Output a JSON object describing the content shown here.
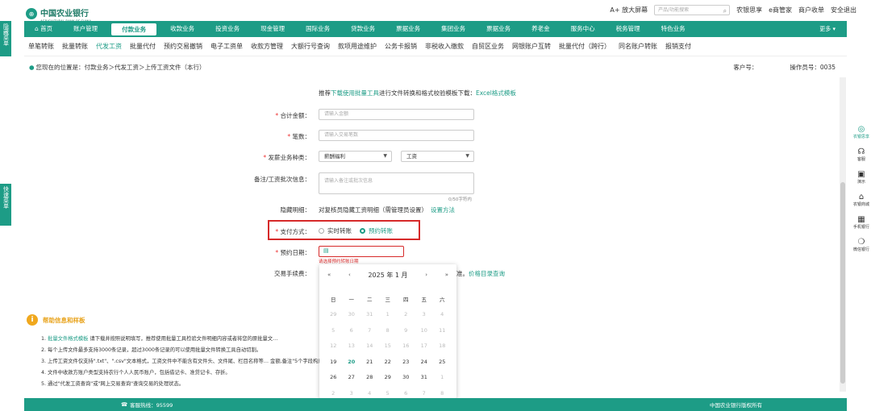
{
  "header": {
    "bank_name": "中国农业银行",
    "bank_sub": "AGRICULTURAL BANK OF CHINA",
    "zoom_label": "A+ 放大屏幕",
    "search_placeholder": "产品/功能搜索",
    "links": [
      "农银思享",
      "e商管家",
      "商户收单",
      "安全退出"
    ]
  },
  "nav": {
    "items": [
      "首页",
      "账户管理",
      "付款业务",
      "收款业务",
      "投资业务",
      "现金管理",
      "国际业务",
      "贷款业务",
      "票据业务",
      "集团业务",
      "票据业务",
      "养老金",
      "服务中心",
      "税务管理",
      "特色业务"
    ],
    "active_index": 2,
    "more": "更多"
  },
  "subnav": {
    "items": [
      "单笔转账",
      "批量转账",
      "代发工资",
      "批量代付",
      "预约交易撤销",
      "电子工资单",
      "收款方管理",
      "大额行号查询",
      "款项用途维护",
      "公务卡报销",
      "非税收入缴款",
      "自贸区业务",
      "网银账户互转",
      "批量代付（跨行）",
      "同名账户转账",
      "报销支付"
    ],
    "active_index": 2
  },
  "breadcrumb": {
    "text": "您现在的位置是：付款业务＞代发工资＞上传工资文件（本行）",
    "customer_label": "客户号：",
    "operator_label": "操作员号：",
    "operator_value": "0035"
  },
  "left_tabs": [
    "隐藏菜单",
    "快速菜单"
  ],
  "right_tools": [
    "农银思享",
    "客服",
    "演示",
    "农银商城",
    "手机银行",
    "微信银行"
  ],
  "form": {
    "notice_prefix": "推荐",
    "notice_link1": "下载使用批量工具",
    "notice_mid": "进行文件转换和格式校验模板下载：",
    "notice_link2": "Excel格式模板",
    "total_label": "合计金额：",
    "total_placeholder": "请输入金额",
    "count_label": "笔数：",
    "count_placeholder": "请输入交易笔数",
    "type_label": "发薪业务种类：",
    "type_value1": "薪酬福利",
    "type_value2": "工资",
    "note_label": "备注/工资批次信息：",
    "note_placeholder": "请输入备注或批次信息",
    "note_counter": "0/50字符内",
    "hidden_label": "隐藏明细：",
    "hidden_text": "对复核员隐藏工资明细（需管理员设置）",
    "hidden_link": "设置方法",
    "pay_label": "支付方式：",
    "pay_option1": "实时转账",
    "pay_option2": "预约转账",
    "date_label": "预约日期：",
    "date_error": "请选择预约转账日期",
    "fee_label": "交易手续费：",
    "fee_tail": "准。",
    "fee_link": "价格目录查询"
  },
  "calendar": {
    "title": "2025 年  1 月",
    "weekdays": [
      "日",
      "一",
      "二",
      "三",
      "四",
      "五",
      "六"
    ],
    "rows": [
      [
        "29",
        "30",
        "31",
        "1",
        "2",
        "3",
        "4"
      ],
      [
        "5",
        "6",
        "7",
        "8",
        "9",
        "10",
        "11"
      ],
      [
        "12",
        "13",
        "14",
        "15",
        "16",
        "17",
        "18"
      ],
      [
        "19",
        "20",
        "21",
        "22",
        "23",
        "24",
        "25"
      ],
      [
        "26",
        "27",
        "28",
        "29",
        "30",
        "31",
        "1"
      ],
      [
        "2",
        "3",
        "4",
        "5",
        "6",
        "7",
        "8"
      ]
    ],
    "today": "20"
  },
  "help": {
    "title": "帮助信息和样板",
    "lines": [
      {
        "num": "1.",
        "link": "批量文件格式模板",
        "text": "请下载并按照说明填写，推荐使用批量工具检验文件明细内容或者将您的原批量文…"
      },
      {
        "num": "2.",
        "link": "",
        "text": "每个上传文件最多支持3000条记录，超过3000条记录的可以使用批量文件转换工具自动切割。"
      },
      {
        "num": "3.",
        "link": "",
        "text": "上传工资文件仅支持\".txt\"、\".csv\"文本格式，工资文件中不能含有文件头、文件尾、栏目名称等…                                                               金额,备注\"5个字段构成，字段用半角\",\"分隔。"
      },
      {
        "num": "4.",
        "link": "",
        "text": "文件中收款方账户类型支持农行个人人民币账户，包括借记卡、准贷记卡、存折。"
      },
      {
        "num": "5.",
        "link": "",
        "text": "通过\"代发工资查询\"或\"网上交易查询\"查询交易的处理状态。"
      }
    ]
  },
  "footer": {
    "hotline": "客服热线：95599",
    "copyright": "中国农业银行版权所有"
  },
  "colors": {
    "brand": "#1d9c86",
    "alert": "#d62a2a",
    "help": "#e8a21a"
  }
}
